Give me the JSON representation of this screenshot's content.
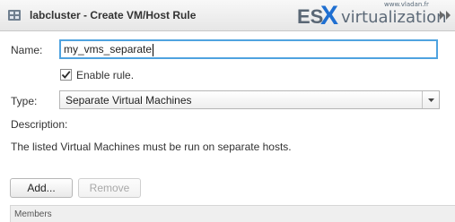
{
  "window": {
    "title": "labcluster - Create VM/Host Rule",
    "title_icon": "cluster-icon",
    "watermark": {
      "url": "www.vladan.fr",
      "text_es": "ES",
      "text_x": "X",
      "text_rest": "virtualization"
    },
    "expand_icon": "double-chevron-right-icon"
  },
  "form": {
    "name_label": "Name:",
    "name_value": "my_vms_separate",
    "enable_rule_label": "Enable rule.",
    "enable_rule_checked": true,
    "type_label": "Type:",
    "type_selected": "Separate Virtual Machines",
    "description_label": "Description:",
    "description_text": "The listed Virtual Machines must be run on separate hosts."
  },
  "buttons": {
    "add_label": "Add...",
    "remove_label": "Remove",
    "remove_disabled": true
  },
  "members_table": {
    "columns": [
      "Members"
    ]
  },
  "colors": {
    "focus_border": "#4fa3e0",
    "logo_blue": "#1f6fd1",
    "logo_gray": "#5d6a78"
  }
}
